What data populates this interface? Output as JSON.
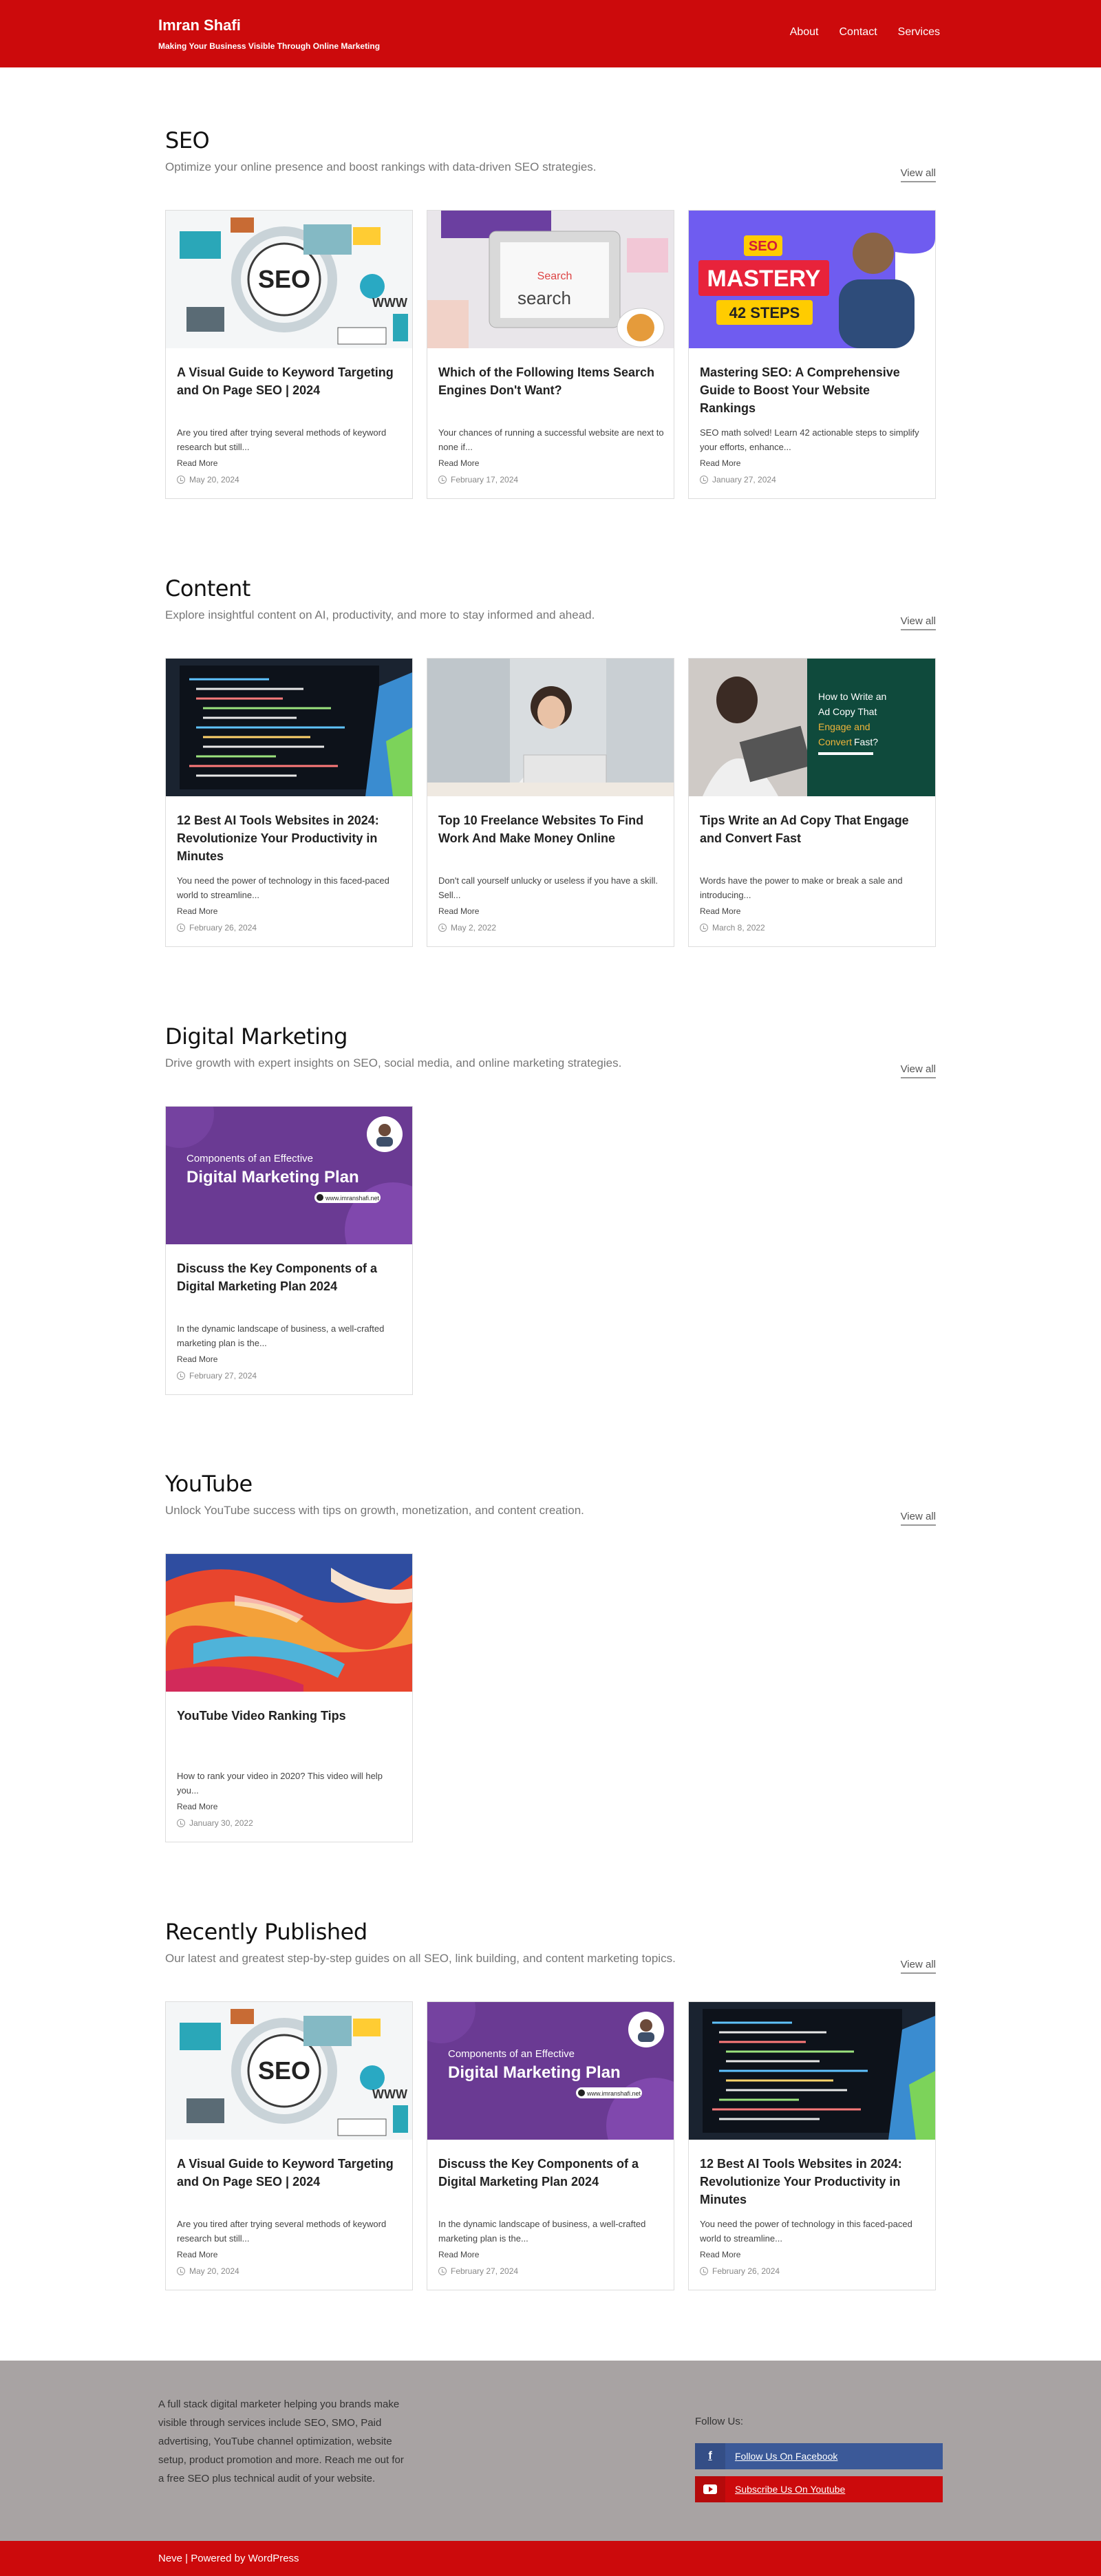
{
  "header": {
    "title": "Imran Shafi",
    "tagline": "Making Your Business Visible Through Online Marketing",
    "nav": [
      "About",
      "Contact",
      "Services"
    ]
  },
  "sections": [
    {
      "title": "SEO",
      "description": "Optimize your online presence and boost rankings with data-driven SEO strategies.",
      "view_all": "View all",
      "cards": [
        {
          "title": "A Visual Guide to Keyword Targeting and On Page SEO | 2024",
          "excerpt": "Are you tired after trying several methods of keyword research but still...",
          "more": "Read More",
          "date": "May 20, 2024",
          "image": "seo-graphic"
        },
        {
          "title": "Which of the Following Items Search Engines Don't Want?",
          "excerpt": "Your chances of running a successful website are next to none if...",
          "more": "Read More",
          "date": "February 17, 2024",
          "image": "search-tablet"
        },
        {
          "title": "Mastering SEO: A Comprehensive Guide to Boost Your Website Rankings",
          "excerpt": "SEO math solved! Learn 42 actionable steps to simplify your efforts, enhance...",
          "more": "Read More",
          "date": "January 27, 2024",
          "image": "seo-mastery"
        }
      ]
    },
    {
      "title": "Content",
      "description": "Explore insightful content on AI, productivity, and more to stay informed and ahead.",
      "view_all": "View all",
      "cards": [
        {
          "title": "12 Best AI Tools Websites in 2024: Revolutionize Your Productivity in Minutes",
          "excerpt": "You need the power of technology in this faced-paced world to streamline...",
          "more": "Read More",
          "date": "February 26, 2024",
          "image": "code-screen"
        },
        {
          "title": "Top 10 Freelance Websites To Find Work And Make Money Online",
          "excerpt": "Don't call yourself unlucky or useless if you have a skill. Sell...",
          "more": "Read More",
          "date": "May 2, 2022",
          "image": "freelancer"
        },
        {
          "title": "Tips Write an Ad Copy That Engage and Convert Fast",
          "excerpt": "Words have the power to make or break a sale and introducing...",
          "more": "Read More",
          "date": "March 8, 2022",
          "image": "ad-copy"
        }
      ]
    },
    {
      "title": "Digital Marketing",
      "description": "Drive growth with expert insights on SEO, social media, and online marketing strategies.",
      "view_all": "View all",
      "cards": [
        {
          "title": "Discuss the Key Components of a Digital Marketing Plan 2024",
          "excerpt": "In the dynamic landscape of business, a well-crafted marketing plan is the...",
          "more": "Read More",
          "date": "February 27, 2024",
          "image": "dm-plan"
        }
      ]
    },
    {
      "title": "YouTube",
      "description": "Unlock YouTube success with tips on growth, monetization, and content creation.",
      "view_all": "View all",
      "cards": [
        {
          "title": "YouTube Video Ranking Tips",
          "excerpt": "How to rank your video in 2020? This video will help you...",
          "more": "Read More",
          "date": "January 30, 2022",
          "image": "paint"
        }
      ]
    },
    {
      "title": "Recently Published",
      "description": "Our latest and greatest step-by-step guides on all SEO, link building, and content marketing topics.",
      "view_all": "View all",
      "cards": [
        {
          "title": "A Visual Guide to Keyword Targeting and On Page SEO | 2024",
          "excerpt": "Are you tired after trying several methods of keyword research but still...",
          "more": "Read More",
          "date": "May 20, 2024",
          "image": "seo-graphic"
        },
        {
          "title": "Discuss the Key Components of a Digital Marketing Plan 2024",
          "excerpt": "In the dynamic landscape of business, a well-crafted marketing plan is the...",
          "more": "Read More",
          "date": "February 27, 2024",
          "image": "dm-plan"
        },
        {
          "title": "12 Best AI Tools Websites in 2024: Revolutionize Your Productivity in Minutes",
          "excerpt": "You need the power of technology in this faced-paced world to streamline...",
          "more": "Read More",
          "date": "February 26, 2024",
          "image": "code-screen"
        }
      ]
    }
  ],
  "image_text": {
    "seo": "SEO",
    "www": "WWW",
    "search_small": "Search",
    "search_big": "search",
    "mastery_tag": "SEO",
    "mastery": "MASTERY",
    "mastery_steps": "42 STEPS",
    "ad_line1": "How to Write an",
    "ad_line2": "Ad Copy That",
    "ad_line3": "Engage and",
    "ad_line4": "Convert",
    "ad_line4b": "Fast?",
    "dm_sub": "Components of an Effective",
    "dm_main": "Digital Marketing Plan",
    "dm_url": "www.imranshafi.net"
  },
  "footer": {
    "about": "A full stack digital marketer helping you brands make visible through services include SEO, SMO, Paid advertising, YouTube channel optimization, website setup, product promotion and more. Reach me out for a free SEO plus technical audit of your website.",
    "follow": "Follow Us:",
    "facebook": "Follow Us On Facebook",
    "youtube": "Subscribe Us On Youtube",
    "credits": "Neve | Powered by WordPress"
  },
  "colors": {
    "brand": "#cc0a0c",
    "footer": "#a8a3a3",
    "facebook": "#3b5998"
  }
}
